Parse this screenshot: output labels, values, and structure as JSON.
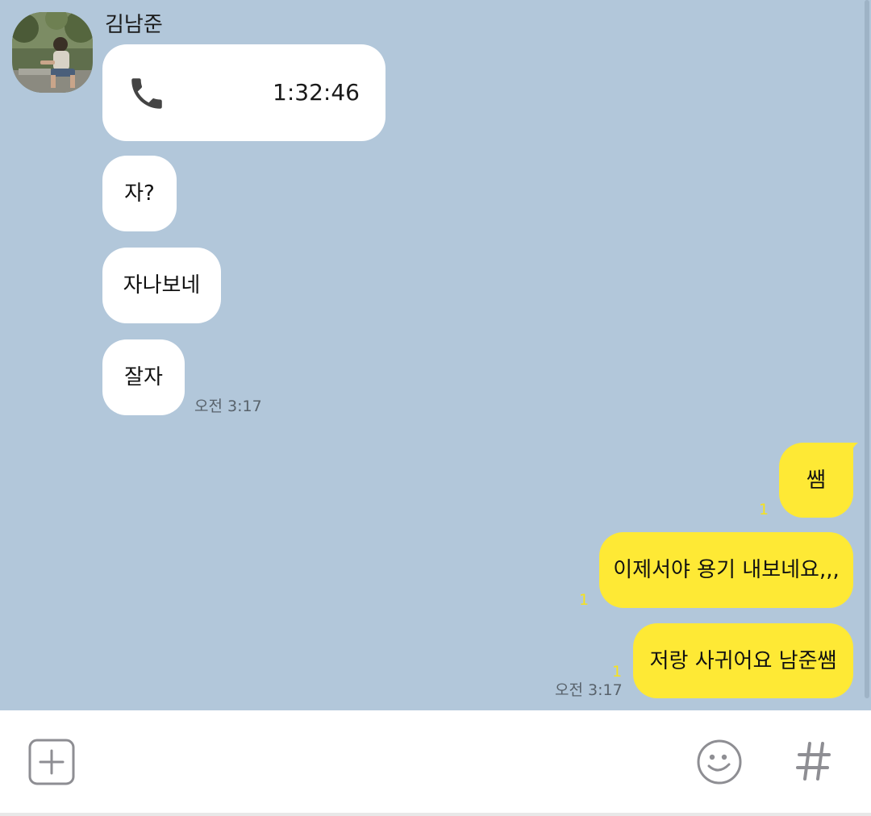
{
  "conversation": {
    "contact_name": "김남준",
    "avatar_icon": "profile-photo"
  },
  "messages_in": {
    "call": {
      "icon": "phone-icon",
      "duration": "1:32:46"
    },
    "msg1": "자?",
    "msg2": "자나보네",
    "msg3": "잘자",
    "time": "오전 3:17"
  },
  "messages_out": {
    "msg1": "쌤",
    "msg1_unread": "1",
    "msg2": "이제서야 용기 내보네요,,,",
    "msg2_unread": "1",
    "msg3": "저랑 사귀어요 남준쌤",
    "msg3_unread": "1",
    "time": "오전 3:17"
  },
  "input_bar": {
    "add_icon": "plus-square-icon",
    "emoji_icon": "smiley-icon",
    "hashtag_icon": "hashtag-icon"
  },
  "colors": {
    "chat_background": "#b2c7da",
    "incoming_bubble": "#ffffff",
    "outgoing_bubble": "#fee935",
    "unread_count": "#f7e21c"
  }
}
